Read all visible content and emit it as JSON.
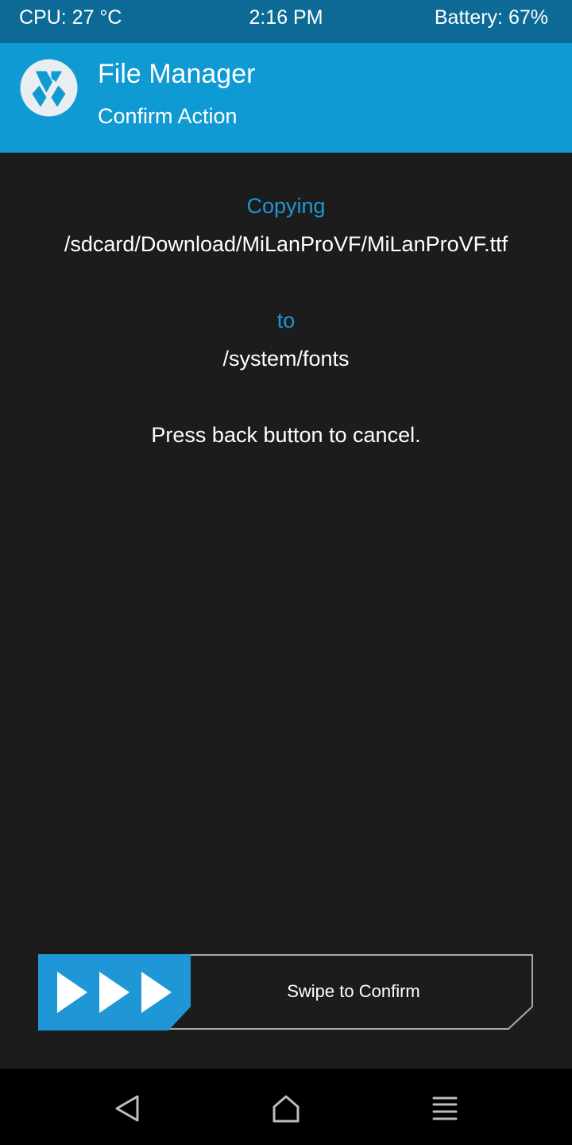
{
  "status_bar": {
    "cpu": "CPU: 27 °C",
    "time": "2:16 PM",
    "battery": "Battery: 67%"
  },
  "header": {
    "title": "File Manager",
    "subtitle": "Confirm Action",
    "logo_icon": "twrp-logo-icon"
  },
  "content": {
    "action_label": "Copying",
    "source_path": "/sdcard/Download/MiLanProVF/MiLanProVF.ttf",
    "to_label": "to",
    "destination_path": "/system/fonts",
    "cancel_hint": "Press back button to cancel."
  },
  "slider": {
    "label": "Swipe to Confirm",
    "handle_icon": "triple-arrow-right-icon"
  },
  "nav_bar": {
    "back_icon": "back-triangle-icon",
    "home_icon": "home-icon",
    "menu_icon": "menu-lines-icon"
  },
  "colors": {
    "status_bar": "#0d6a97",
    "header": "#0f9ad4",
    "accent_text": "#1f96d5",
    "background": "#1c1c1c"
  }
}
